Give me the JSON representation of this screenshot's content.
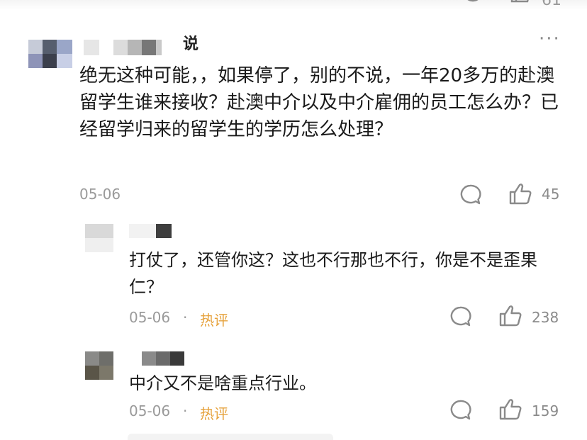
{
  "top_partial": {
    "count": "61"
  },
  "main_comment": {
    "said": "说",
    "more": "···",
    "text": "绝无这种可能，，如果停了，别的不说，一年20多万的赴澳留学生谁来接收？赴澳中介以及中介雇佣的员工怎么办？已经留学归来的留学生的学历怎么处理？",
    "date": "05-06",
    "likes": "45"
  },
  "replies": [
    {
      "text": "打仗了，还管你这？这也不行那也不行，你是不是歪果仁？",
      "date": "05-06",
      "separator": "·",
      "badge": "热评",
      "likes": "238"
    },
    {
      "text": "中介又不是啥重点行业。",
      "date": "05-06",
      "separator": "·",
      "badge": "热评",
      "likes": "159"
    }
  ],
  "colors": {
    "hot_badge": "#e6a23c",
    "meta_gray": "#9a9a9a",
    "icon_gray": "#8a8a8a"
  },
  "icons": [
    "comment-icon",
    "like-icon",
    "more-icon"
  ]
}
